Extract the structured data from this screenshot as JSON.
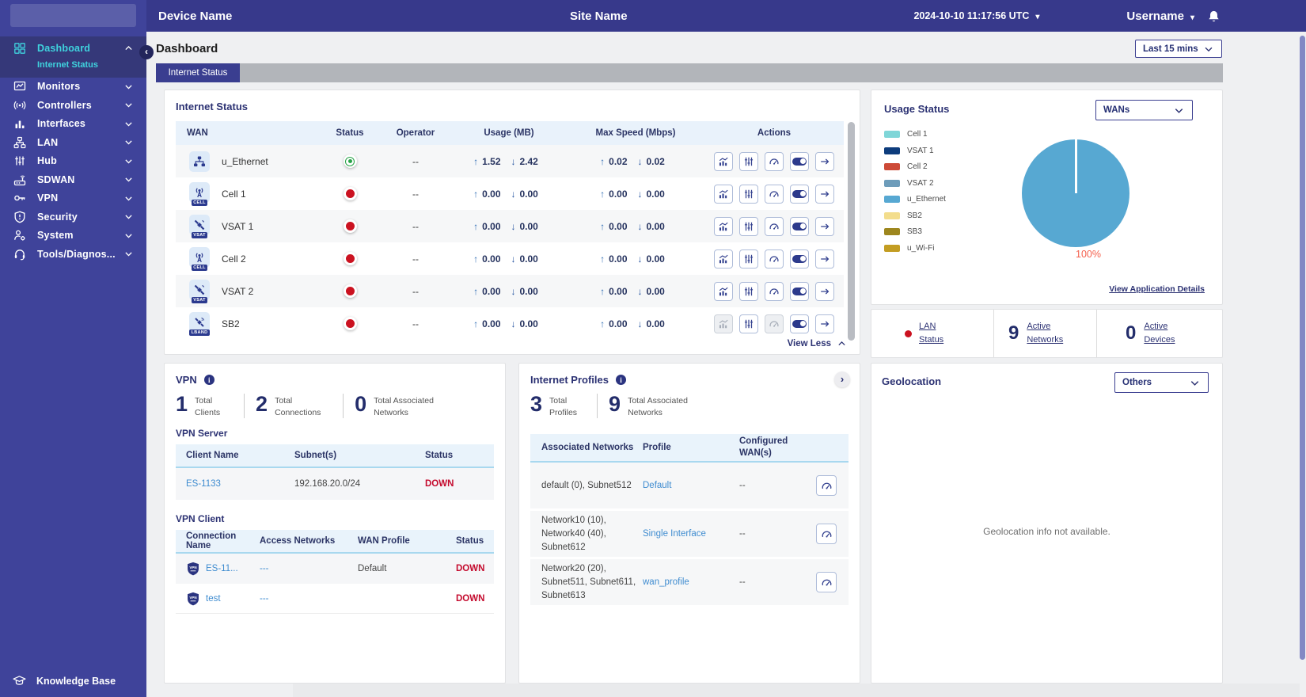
{
  "topbar": {
    "device_name": "Device Name",
    "site_name": "Site Name",
    "timestamp": "2024-10-10 11:17:56 UTC",
    "username": "Username"
  },
  "sidebar": {
    "items": [
      {
        "label": "Dashboard"
      },
      {
        "label": "Monitors"
      },
      {
        "label": "Controllers"
      },
      {
        "label": "Interfaces"
      },
      {
        "label": "LAN"
      },
      {
        "label": "Hub"
      },
      {
        "label": "SDWAN"
      },
      {
        "label": "VPN"
      },
      {
        "label": "Security"
      },
      {
        "label": "System"
      },
      {
        "label": "Tools/Diagnos..."
      }
    ],
    "active_item": "Dashboard",
    "active_sub": "Internet Status",
    "footer": "Knowledge Base"
  },
  "page": {
    "title": "Dashboard",
    "time_filter": "Last 15 mins",
    "active_tab": "Internet Status"
  },
  "internet_status": {
    "title": "Internet Status",
    "columns": {
      "wan": "WAN",
      "status": "Status",
      "operator": "Operator",
      "usage": "Usage (MB)",
      "max_speed": "Max Speed (Mbps)",
      "actions": "Actions"
    },
    "rows": [
      {
        "name": "u_Ethernet",
        "badge": "",
        "status": "up",
        "operator": "--",
        "usage_up": "1.52",
        "usage_down": "2.42",
        "speed_up": "0.02",
        "speed_down": "0.02"
      },
      {
        "name": "Cell 1",
        "badge": "CELL",
        "status": "down",
        "operator": "--",
        "usage_up": "0.00",
        "usage_down": "0.00",
        "speed_up": "0.00",
        "speed_down": "0.00"
      },
      {
        "name": "VSAT 1",
        "badge": "VSAT",
        "status": "down",
        "operator": "--",
        "usage_up": "0.00",
        "usage_down": "0.00",
        "speed_up": "0.00",
        "speed_down": "0.00"
      },
      {
        "name": "Cell 2",
        "badge": "CELL",
        "status": "down",
        "operator": "--",
        "usage_up": "0.00",
        "usage_down": "0.00",
        "speed_up": "0.00",
        "speed_down": "0.00"
      },
      {
        "name": "VSAT 2",
        "badge": "VSAT",
        "status": "down",
        "operator": "--",
        "usage_up": "0.00",
        "usage_down": "0.00",
        "speed_up": "0.00",
        "speed_down": "0.00"
      },
      {
        "name": "SB2",
        "badge": "LBAND",
        "status": "down",
        "operator": "--",
        "usage_up": "0.00",
        "usage_down": "0.00",
        "speed_up": "0.00",
        "speed_down": "0.00"
      }
    ],
    "view_less": "View Less"
  },
  "usage_status": {
    "title": "Usage Status",
    "filter": "WANs",
    "legend": [
      {
        "label": "Cell 1",
        "color": "#7fd6d8"
      },
      {
        "label": "VSAT 1",
        "color": "#0d3c7c"
      },
      {
        "label": "Cell 2",
        "color": "#cd4a37"
      },
      {
        "label": "VSAT 2",
        "color": "#6d9cba"
      },
      {
        "label": "u_Ethernet",
        "color": "#57a8d2"
      },
      {
        "label": "SB2",
        "color": "#f3dd8c"
      },
      {
        "label": "SB3",
        "color": "#9d861e"
      },
      {
        "label": "u_Wi-Fi",
        "color": "#c39d22"
      }
    ],
    "link": "View Application Details",
    "chart_data": {
      "type": "pie",
      "slices": [
        {
          "label": "u_Ethernet",
          "value": 100,
          "color": "#57a8d2"
        }
      ],
      "data_label": "100%",
      "data_label_color": "#f4614e",
      "legend_position": "left"
    }
  },
  "lan_summary": {
    "lan_status_label": "LAN Status",
    "active_networks": {
      "value": "9",
      "label": "Active Networks"
    },
    "active_devices": {
      "value": "0",
      "label": "Active Devices"
    }
  },
  "vpn": {
    "title": "VPN",
    "stats": [
      {
        "value": "1",
        "label": "Total Clients"
      },
      {
        "value": "2",
        "label": "Total Connections"
      },
      {
        "value": "0",
        "label": "Total Associated Networks"
      }
    ],
    "server": {
      "title": "VPN Server",
      "columns": {
        "client": "Client Name",
        "subnets": "Subnet(s)",
        "status": "Status"
      },
      "rows": [
        {
          "client": "ES-1133",
          "subnets": "192.168.20.0/24",
          "status": "DOWN"
        }
      ]
    },
    "client": {
      "title": "VPN Client",
      "columns": {
        "connection": "Connection Name",
        "access": "Access Networks",
        "wan_profile": "WAN Profile",
        "status": "Status"
      },
      "rows": [
        {
          "connection": "ES-11...",
          "access": "---",
          "wan_profile": "Default",
          "status": "DOWN"
        },
        {
          "connection": "test",
          "access": "---",
          "wan_profile": "",
          "status": "DOWN"
        }
      ]
    }
  },
  "internet_profiles": {
    "title": "Internet Profiles",
    "stats": [
      {
        "value": "3",
        "label": "Total Profiles"
      },
      {
        "value": "9",
        "label": "Total Associated Networks"
      }
    ],
    "columns": {
      "networks": "Associated Networks",
      "profile": "Profile",
      "wans": "Configured WAN(s)"
    },
    "rows": [
      {
        "networks": "default (0), Subnet512",
        "profile": "Default",
        "wans": "--"
      },
      {
        "networks": "Network10 (10), Network40 (40), Subnet612",
        "profile": "Single Interface",
        "wans": "--"
      },
      {
        "networks": "Network20 (20), Subnet511, Subnet611, Subnet613",
        "profile": "wan_profile",
        "wans": "--"
      }
    ]
  },
  "geolocation": {
    "title": "Geolocation",
    "filter": "Others",
    "empty_text": "Geolocation info not available."
  },
  "colors": {
    "sidebar": "#3f439a",
    "topbar": "#37398b",
    "accent_cyan": "#3fd3de",
    "status_up_green": "#27a348",
    "status_down_red": "#c40a2d",
    "link_blue": "#3f8cd0",
    "pie_blue": "#57a8d2"
  }
}
